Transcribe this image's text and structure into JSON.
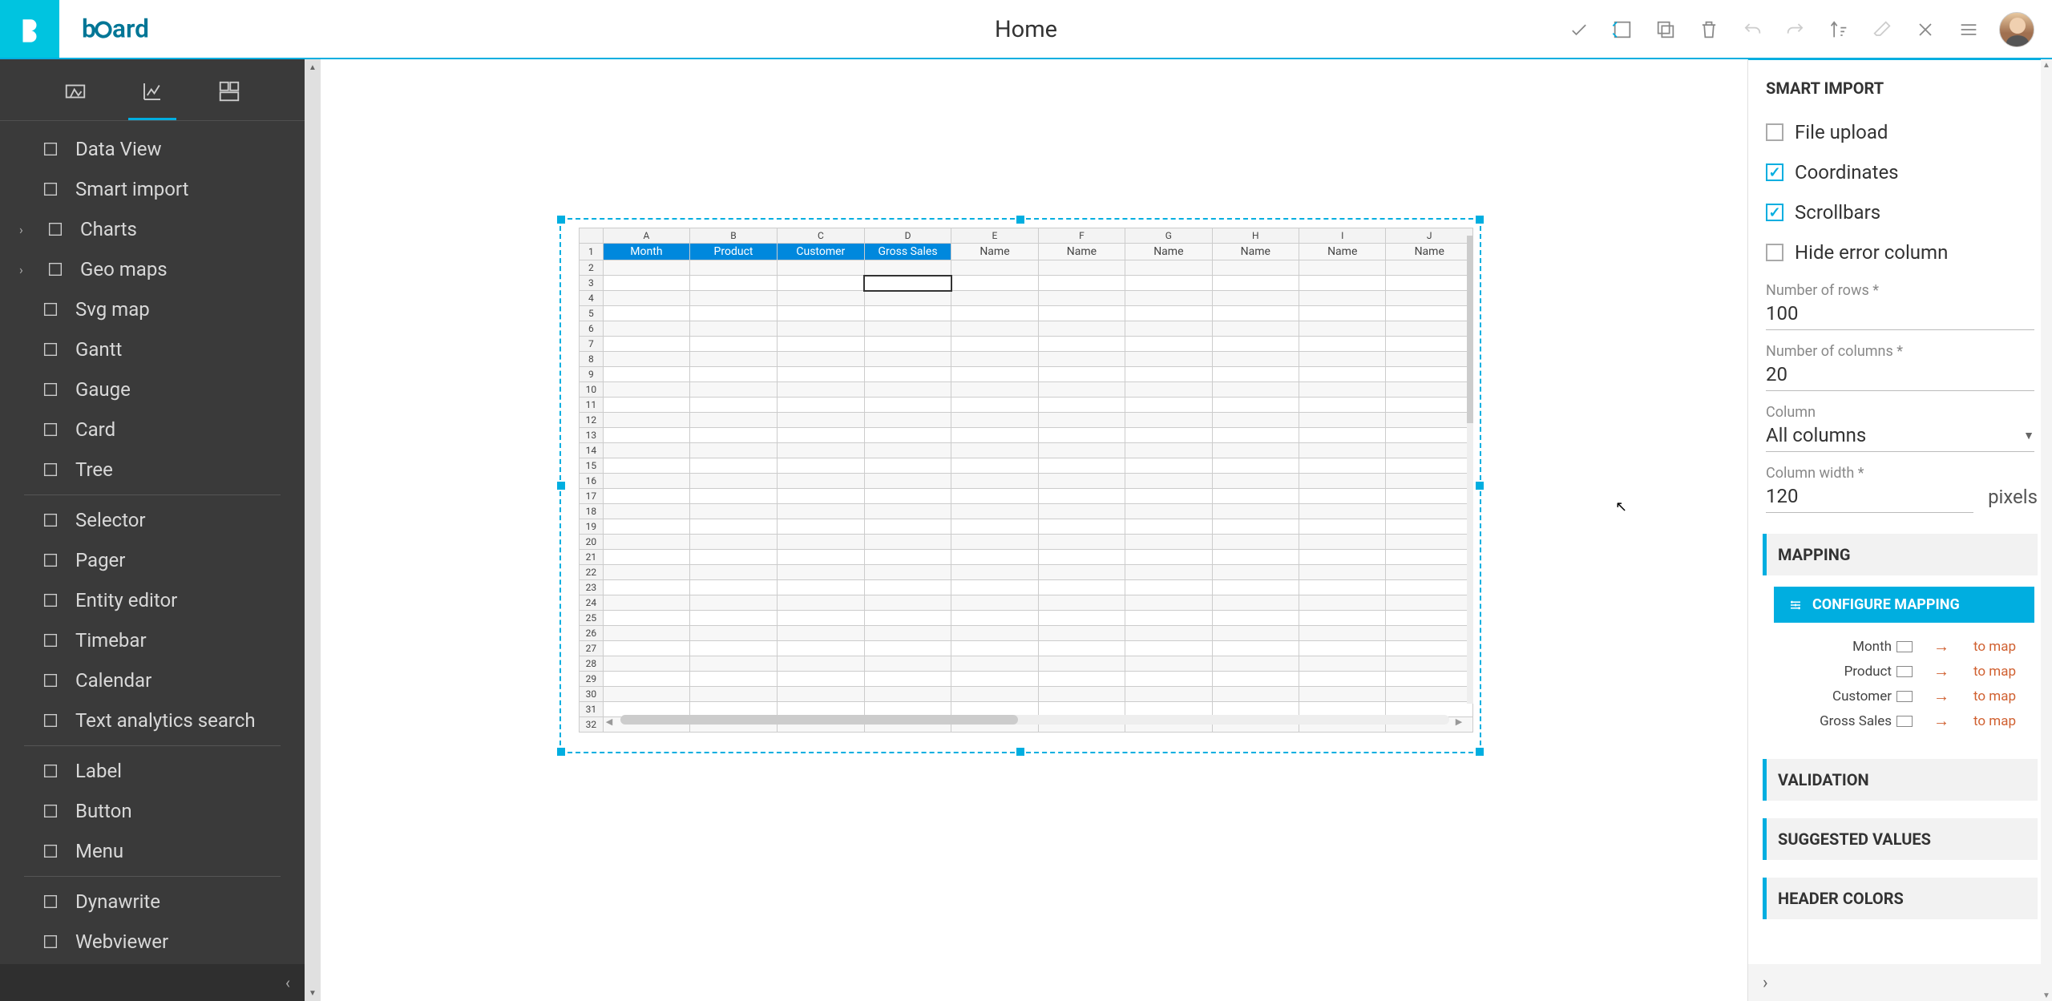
{
  "header": {
    "title": "Home"
  },
  "sidebar": {
    "items": [
      {
        "label": "Data View",
        "icon": "grid",
        "expand": false
      },
      {
        "label": "Smart import",
        "icon": "grid",
        "expand": false
      },
      {
        "label": "Charts",
        "icon": "chart",
        "expand": true
      },
      {
        "label": "Geo maps",
        "icon": "globe",
        "expand": true
      },
      {
        "label": "Svg map",
        "icon": "map",
        "expand": false
      },
      {
        "label": "Gantt",
        "icon": "gantt",
        "expand": false
      },
      {
        "label": "Gauge",
        "icon": "gauge",
        "expand": false
      },
      {
        "label": "Card",
        "icon": "card",
        "expand": false
      },
      {
        "label": "Tree",
        "icon": "tree",
        "expand": false
      },
      {
        "label": "Selector",
        "icon": "selector",
        "expand": false,
        "sep": true
      },
      {
        "label": "Pager",
        "icon": "pager",
        "expand": false
      },
      {
        "label": "Entity editor",
        "icon": "entity",
        "expand": false
      },
      {
        "label": "Timebar",
        "icon": "timebar",
        "expand": false
      },
      {
        "label": "Calendar",
        "icon": "calendar",
        "expand": false
      },
      {
        "label": "Text analytics search",
        "icon": "search",
        "expand": false
      },
      {
        "label": "Label",
        "icon": "label",
        "expand": false,
        "sep": true
      },
      {
        "label": "Button",
        "icon": "button",
        "expand": false
      },
      {
        "label": "Menu",
        "icon": "menu",
        "expand": false
      },
      {
        "label": "Dynawrite",
        "icon": "dyna",
        "expand": false,
        "sep": true
      },
      {
        "label": "Webviewer",
        "icon": "web",
        "expand": false
      }
    ]
  },
  "sheet": {
    "cols": [
      "A",
      "B",
      "C",
      "D",
      "E",
      "F",
      "G",
      "H",
      "I",
      "J"
    ],
    "rows": 32,
    "headers": [
      {
        "label": "Month",
        "mapped": true
      },
      {
        "label": "Product",
        "mapped": true
      },
      {
        "label": "Customer",
        "mapped": true
      },
      {
        "label": "Gross Sales",
        "mapped": true
      },
      {
        "label": "Name",
        "mapped": false
      },
      {
        "label": "Name",
        "mapped": false
      },
      {
        "label": "Name",
        "mapped": false
      },
      {
        "label": "Name",
        "mapped": false
      },
      {
        "label": "Name",
        "mapped": false
      },
      {
        "label": "Name",
        "mapped": false
      }
    ],
    "selected": {
      "row": 3,
      "col": 3
    }
  },
  "panel": {
    "title": "SMART IMPORT",
    "checks": [
      {
        "label": "File upload",
        "checked": false
      },
      {
        "label": "Coordinates",
        "checked": true
      },
      {
        "label": "Scrollbars",
        "checked": true
      },
      {
        "label": "Hide error column",
        "checked": false
      }
    ],
    "rows": {
      "label": "Number of rows",
      "value": "100"
    },
    "cols": {
      "label": "Number of columns",
      "value": "20"
    },
    "column": {
      "label": "Column",
      "value": "All columns"
    },
    "colwidth": {
      "label": "Column width",
      "value": "120",
      "unit": "pixels"
    },
    "mapping_title": "MAPPING",
    "mapping_btn": "CONFIGURE MAPPING",
    "mapping": [
      {
        "name": "Month",
        "status": "to map"
      },
      {
        "name": "Product",
        "status": "to map"
      },
      {
        "name": "Customer",
        "status": "to map"
      },
      {
        "name": "Gross Sales",
        "status": "to map"
      }
    ],
    "validation_title": "VALIDATION",
    "suggested_title": "SUGGESTED VALUES",
    "headercolors_title": "HEADER COLORS"
  }
}
